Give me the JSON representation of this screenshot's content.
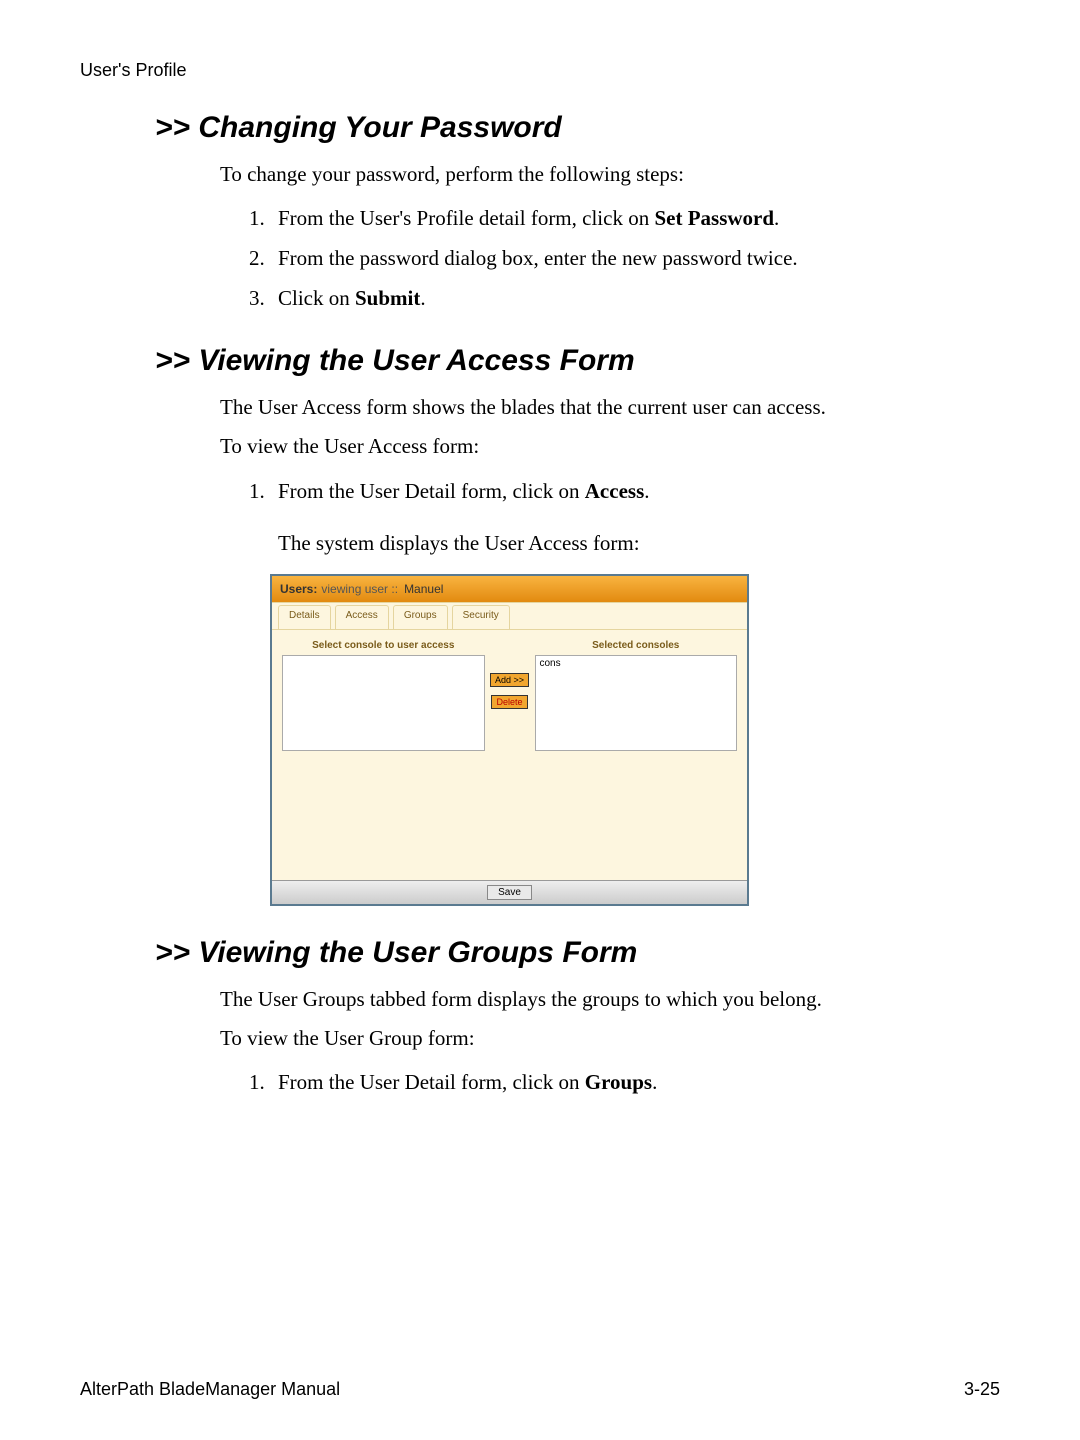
{
  "header": "User's Profile",
  "sections": {
    "pw": {
      "title": ">> Changing Your Password",
      "intro": "To change your password, perform the following steps:",
      "step1_pre": "From the User's Profile detail form, click on ",
      "step1_bold": "Set Password",
      "step1_post": ".",
      "step2": "From the password dialog box, enter the new password twice.",
      "step3_pre": "Click on ",
      "step3_bold": "Submit",
      "step3_post": "."
    },
    "access": {
      "title": ">> Viewing the User Access Form",
      "intro1": "The User Access form shows the blades that the current user can access.",
      "intro2": "To view the User Access form:",
      "step1_pre": "From the User Detail form, click on ",
      "step1_bold": "Access",
      "step1_post": ".",
      "step1_after": "The system displays the User Access form:"
    },
    "groups": {
      "title": ">> Viewing the User Groups Form",
      "intro1": "The User Groups tabbed form displays the groups to which you belong.",
      "intro2": "To view the User Group form:",
      "step1_pre": "From the User Detail form, click on ",
      "step1_bold": "Groups",
      "step1_post": "."
    }
  },
  "ui": {
    "title_main": "Users:",
    "title_sub": "viewing user ::",
    "title_user": "Manuel",
    "tabs": [
      "Details",
      "Access",
      "Groups",
      "Security"
    ],
    "label_left": "Select console to user access",
    "label_right": "Selected consoles",
    "left_items": [],
    "right_items": [
      "cons"
    ],
    "btn_add": "Add >>",
    "btn_delete": "Delete",
    "btn_save": "Save"
  },
  "footer": {
    "left": "AlterPath BladeManager Manual",
    "right": "3-25"
  }
}
